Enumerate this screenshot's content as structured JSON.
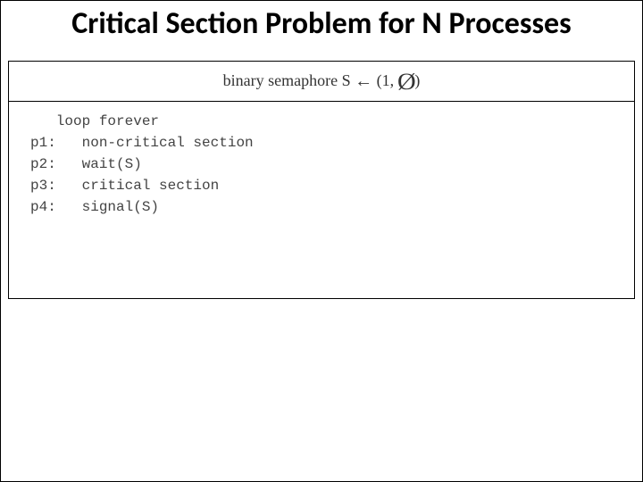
{
  "title": "Critical Section Problem for N Processes",
  "header": {
    "prefix": "binary semaphore S ",
    "arrow": "←",
    "open": " (1, ",
    "empty": "Ø",
    "close": ")"
  },
  "code": {
    "l0": "   loop forever",
    "l1": "p1:   non-critical section",
    "l2": "p2:   wait(S)",
    "l3": "p3:   critical section",
    "l4": "p4:   signal(S)"
  }
}
